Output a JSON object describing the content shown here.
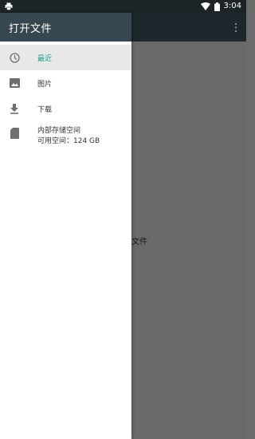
{
  "status_bar": {
    "time": "3:04"
  },
  "drawer": {
    "title": "打开文件",
    "items": [
      {
        "label": "最近",
        "icon": "clock-icon",
        "active": true
      },
      {
        "label": "图片",
        "icon": "image-icon",
        "active": false
      },
      {
        "label": "下载",
        "icon": "download-icon",
        "active": false
      },
      {
        "label": "内部存储空间",
        "sublabel": "可用空间：124 GB",
        "icon": "sd-card-icon",
        "active": false
      }
    ]
  },
  "main": {
    "empty_text": "文件"
  },
  "colors": {
    "header": "#37474f",
    "status_bar": "#1d2428",
    "accent": "#1e9f8b",
    "scrim": "#696969"
  }
}
